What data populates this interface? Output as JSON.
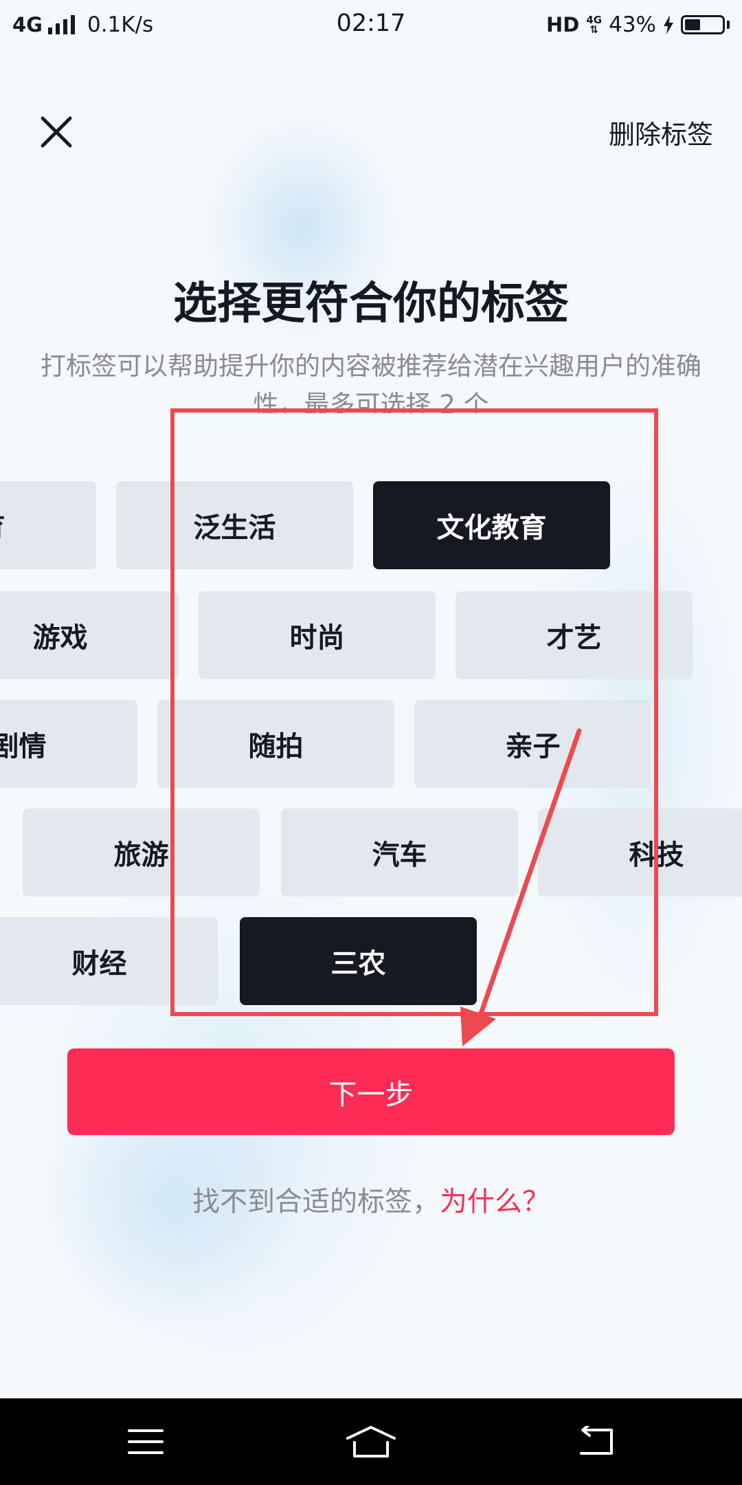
{
  "status_bar": {
    "network": "4G",
    "speed": "0.1K/s",
    "time": "02:17",
    "hd": "HD",
    "net_type": "4G",
    "battery_percent": "43%",
    "battery_level": 0.43,
    "icons": [
      "signal-icon",
      "charging-icon",
      "battery-icon"
    ]
  },
  "header": {
    "close_icon": "close-icon",
    "delete_label": "删除标签"
  },
  "title": "选择更符合你的标签",
  "subtitle": "打标签可以帮助提升你的内容被推荐给潜在兴趣用户的准确性，最多可选择 2 个",
  "tags": [
    {
      "label": "体育",
      "selected": false
    },
    {
      "label": "泛生活",
      "selected": false
    },
    {
      "label": "文化教育",
      "selected": true
    },
    {
      "label": "游戏",
      "selected": false
    },
    {
      "label": "时尚",
      "selected": false
    },
    {
      "label": "才艺",
      "selected": false
    },
    {
      "label": "剧情",
      "selected": false
    },
    {
      "label": "随拍",
      "selected": false
    },
    {
      "label": "亲子",
      "selected": false
    },
    {
      "label": "旅游",
      "selected": false
    },
    {
      "label": "汽车",
      "selected": false
    },
    {
      "label": "科技",
      "selected": false
    },
    {
      "label": "财经",
      "selected": false
    },
    {
      "label": "三农",
      "selected": true
    }
  ],
  "next_label": "下一步",
  "help": {
    "text": "找不到合适的标签，",
    "link": "为什么？"
  },
  "nav_bar": {
    "icons": [
      "menu-icon",
      "home-icon",
      "back-icon"
    ]
  },
  "colors": {
    "accent": "#fe2c55",
    "tag_bg": "#e2e8ee",
    "tag_selected_bg": "#161823",
    "annotation": "#ec4a4e"
  }
}
